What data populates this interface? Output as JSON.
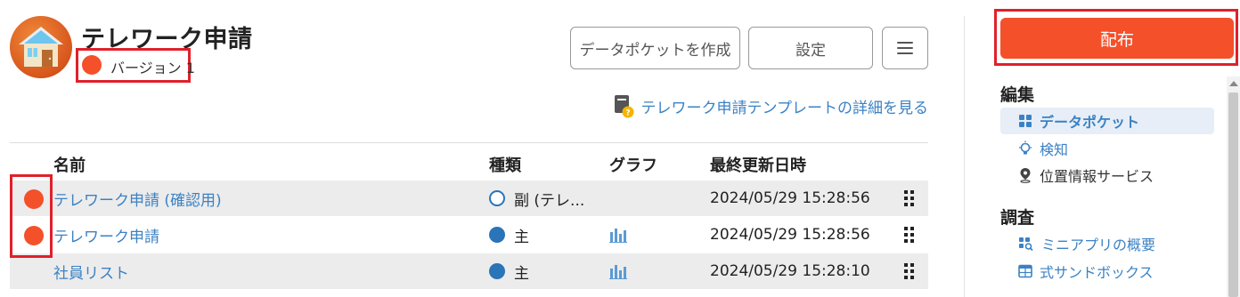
{
  "app": {
    "title": "テレワーク申請",
    "version_label": "バージョン 1",
    "icon": "house-icon"
  },
  "header": {
    "create_pocket_button": "データポケットを作成",
    "settings_button": "設定",
    "menu_icon": "hamburger-menu-icon",
    "template_link": "テレワーク申請テンプレートの詳細を見る",
    "template_icon": "book-help-icon"
  },
  "table": {
    "columns": [
      "名前",
      "種類",
      "グラフ",
      "最終更新日時"
    ],
    "rows": [
      {
        "status": "red-dot",
        "name": "テレワーク申請 (確認用)",
        "type_icon": "ring",
        "type": "副 (テレ...",
        "graph": false,
        "updated": "2024/05/29 15:28:56"
      },
      {
        "status": "red-dot",
        "name": "テレワーク申請",
        "type_icon": "solid",
        "type": "主",
        "graph": true,
        "updated": "2024/05/29 15:28:56"
      },
      {
        "status": "none",
        "name": "社員リスト",
        "type_icon": "solid",
        "type": "主",
        "graph": true,
        "updated": "2024/05/29 15:28:10"
      }
    ]
  },
  "sidebar": {
    "deploy_button": "配布",
    "sections": [
      {
        "title": "編集",
        "items": [
          {
            "label": "データポケット",
            "icon": "grid-icon",
            "state": "active"
          },
          {
            "label": "検知",
            "icon": "lightbulb-icon",
            "state": "link"
          },
          {
            "label": "位置情報サービス",
            "icon": "location-pin-icon",
            "state": "plain"
          }
        ]
      },
      {
        "title": "調査",
        "items": [
          {
            "label": "ミニアプリの概要",
            "icon": "grid-search-icon",
            "state": "link"
          },
          {
            "label": "式サンドボックス",
            "icon": "table-calc-icon",
            "state": "link"
          }
        ]
      }
    ]
  },
  "colors": {
    "accent_orange": "#f4502a",
    "highlight_red": "#e0202a",
    "link_blue": "#3b82c4",
    "row_shade": "#ececec"
  }
}
